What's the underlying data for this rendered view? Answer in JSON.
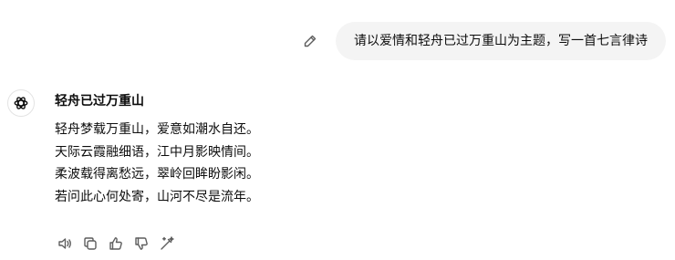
{
  "user_message": "请以爱情和轻舟已过万重山为主题，写一首七言律诗",
  "assistant": {
    "title": "轻舟已过万重山",
    "lines": [
      "轻舟梦载万重山，爱意如潮水自还。",
      "天际云霞融细语，江中月影映情间。",
      "柔波载得离愁远，翠岭回眸盼影闲。",
      "若问此心何处寄，山河不尽是流年。"
    ]
  },
  "icons": {
    "edit": "pencil-icon",
    "avatar": "openai-logo-icon",
    "actions": [
      "speaker-icon",
      "copy-icon",
      "thumbs-up-icon",
      "thumbs-down-icon",
      "regenerate-icon"
    ]
  },
  "colors": {
    "bubble_bg": "#f4f4f4",
    "text": "#0d0d0d",
    "icon": "#5d5d5d"
  }
}
